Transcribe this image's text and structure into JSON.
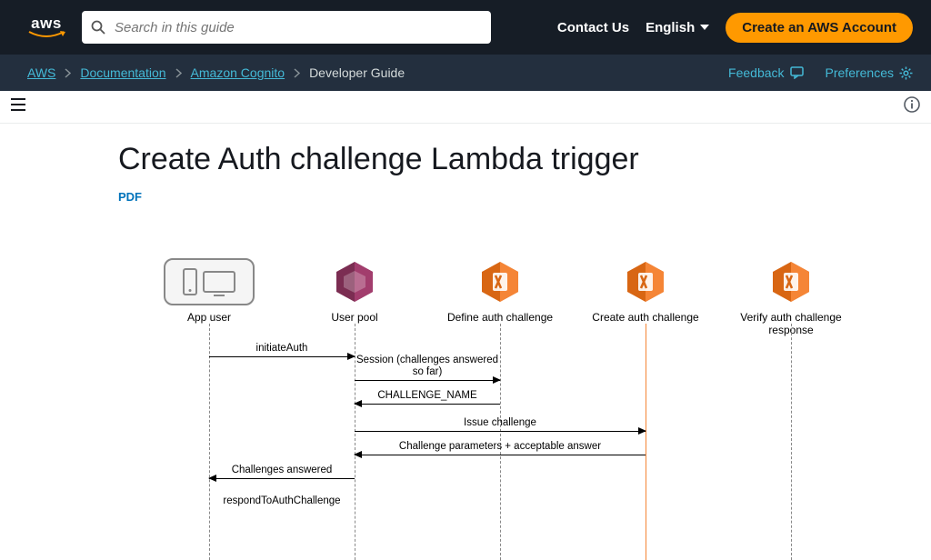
{
  "topnav": {
    "search_placeholder": "Search in this guide",
    "contact": "Contact Us",
    "language": "English",
    "cta": "Create an AWS Account"
  },
  "breadcrumbs": {
    "items": [
      "AWS",
      "Documentation",
      "Amazon Cognito",
      "Developer Guide"
    ],
    "feedback": "Feedback",
    "preferences": "Preferences"
  },
  "page": {
    "title": "Create Auth challenge Lambda trigger",
    "pdf": "PDF"
  },
  "diagram": {
    "actors": {
      "app_user": "App user",
      "user_pool": "User pool",
      "define": "Define auth challenge",
      "create": "Create auth challenge",
      "verify": "Verify auth challenge response"
    },
    "messages": {
      "initiate": "initiateAuth",
      "session": "Session (challenges answered so far)",
      "challenge_name": "CHALLENGE_NAME",
      "issue": "Issue challenge",
      "params": "Challenge parameters + acceptable answer",
      "answered": "Challenges answered",
      "respond": "respondToAuthChallenge"
    }
  }
}
